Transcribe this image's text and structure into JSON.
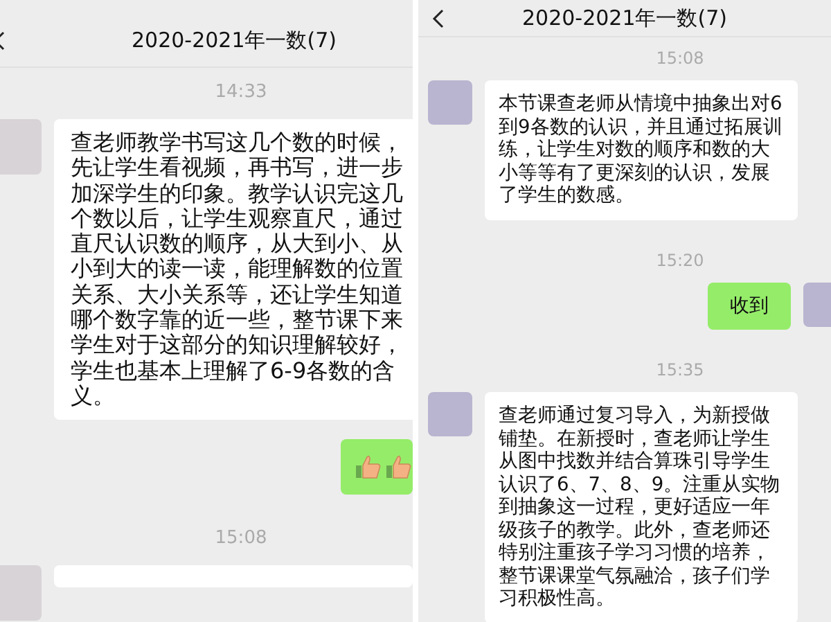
{
  "panels": [
    {
      "header": {
        "title": "2020-2021年一数(7)"
      },
      "messages": [
        {
          "kind": "time",
          "text": "14:33"
        },
        {
          "kind": "incoming",
          "text": "查老师教学书写这几个数的时候，先让学生看视频，再书写，进一步加深学生的印象。教学认识完这几个数以后，让学生观察直尺，通过直尺认识数的顺序，从大到小、从小到大的读一读，能理解数的位置关系、大小关系等，还让学生知道哪个数字靠的近一些，整节课下来学生对于这部分的知识理解较好，学生也基本上理解了6-9各数的含义。"
        },
        {
          "kind": "thumbs"
        },
        {
          "kind": "time",
          "text": "15:08"
        },
        {
          "kind": "partial"
        }
      ]
    },
    {
      "header": {
        "title": "2020-2021年一数(7)"
      },
      "messages": [
        {
          "kind": "time",
          "text": "15:08"
        },
        {
          "kind": "incoming",
          "text": "本节课查老师从情境中抽象出对6到9各数的认识，并且通过拓展训练，让学生对数的顺序和数的大小等等有了更深刻的认识，发展了学生的数感。"
        },
        {
          "kind": "time",
          "text": "15:20"
        },
        {
          "kind": "outgoing",
          "text": "收到"
        },
        {
          "kind": "time",
          "text": "15:35"
        },
        {
          "kind": "incoming",
          "text": "查老师通过复习导入，为新授做铺垫。在新授时，查老师让学生从图中找数并结合算珠引导学生认识了6、7、8、9。注重从实物到抽象这一过程，更好适应一年级孩子的教学。此外，查老师还特别注重孩子学习习惯的培养，整节课课堂气氛融洽，孩子们学习积极性高。"
        }
      ]
    }
  ]
}
